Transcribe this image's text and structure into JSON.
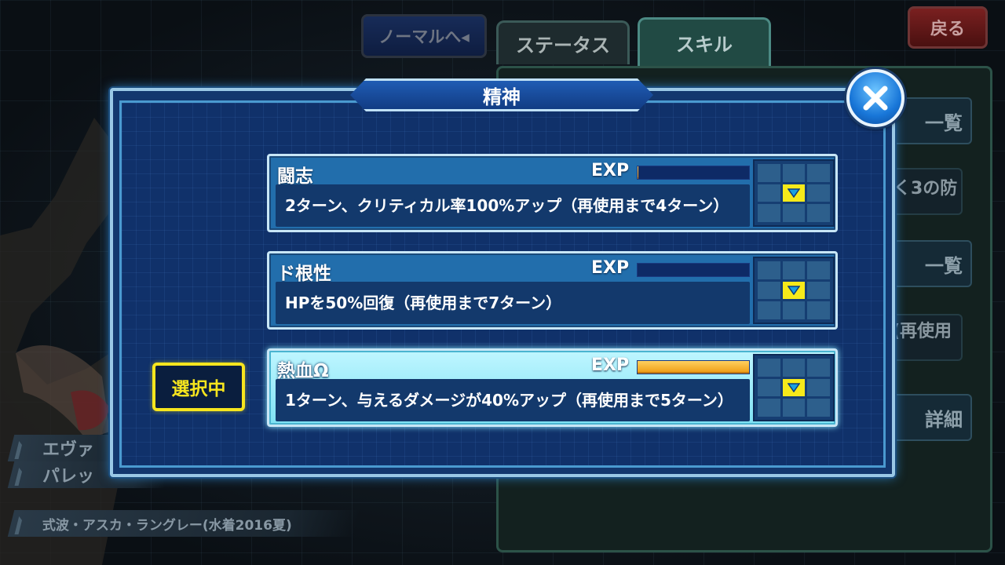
{
  "background": {
    "mode_button_label": "ノーマルへ◂",
    "tabs": [
      {
        "label": "ステータス"
      },
      {
        "label": "スキル"
      }
    ],
    "back_button_label": "戻る",
    "right_panel_fragments": [
      "一覧",
      "く3の防",
      "一覧",
      "(再使用",
      "詳細"
    ],
    "name_plates": [
      "エヴァ",
      "パレッ",
      "式波・アスカ・ラングレー(水着2016夏)"
    ]
  },
  "dialog": {
    "title": "精神",
    "selected_label": "選択中",
    "skills": [
      {
        "name": "闘志",
        "exp_label": "EXP",
        "exp_progress": 0.01,
        "description": "2ターン、クリティカル率100%アップ（再使用まで4ターン）",
        "selected": false
      },
      {
        "name": "ド根性",
        "exp_label": "EXP",
        "exp_progress": 0.0,
        "description": "HPを50%回復（再使用まで7ターン）",
        "selected": false
      },
      {
        "name": "熱血Ω",
        "exp_label": "EXP",
        "exp_progress": 1.0,
        "description": "1ターン、与えるダメージが40%アップ（再使用まで5ターン）",
        "selected": true
      }
    ]
  },
  "colors": {
    "dialog_bg": "#10316a",
    "selected_accent": "#f6e51e",
    "exp_fill": "#f0a018"
  },
  "icons": {
    "close": "close-x-icon",
    "grid_marker": "yellow-down-triangle-icon"
  }
}
